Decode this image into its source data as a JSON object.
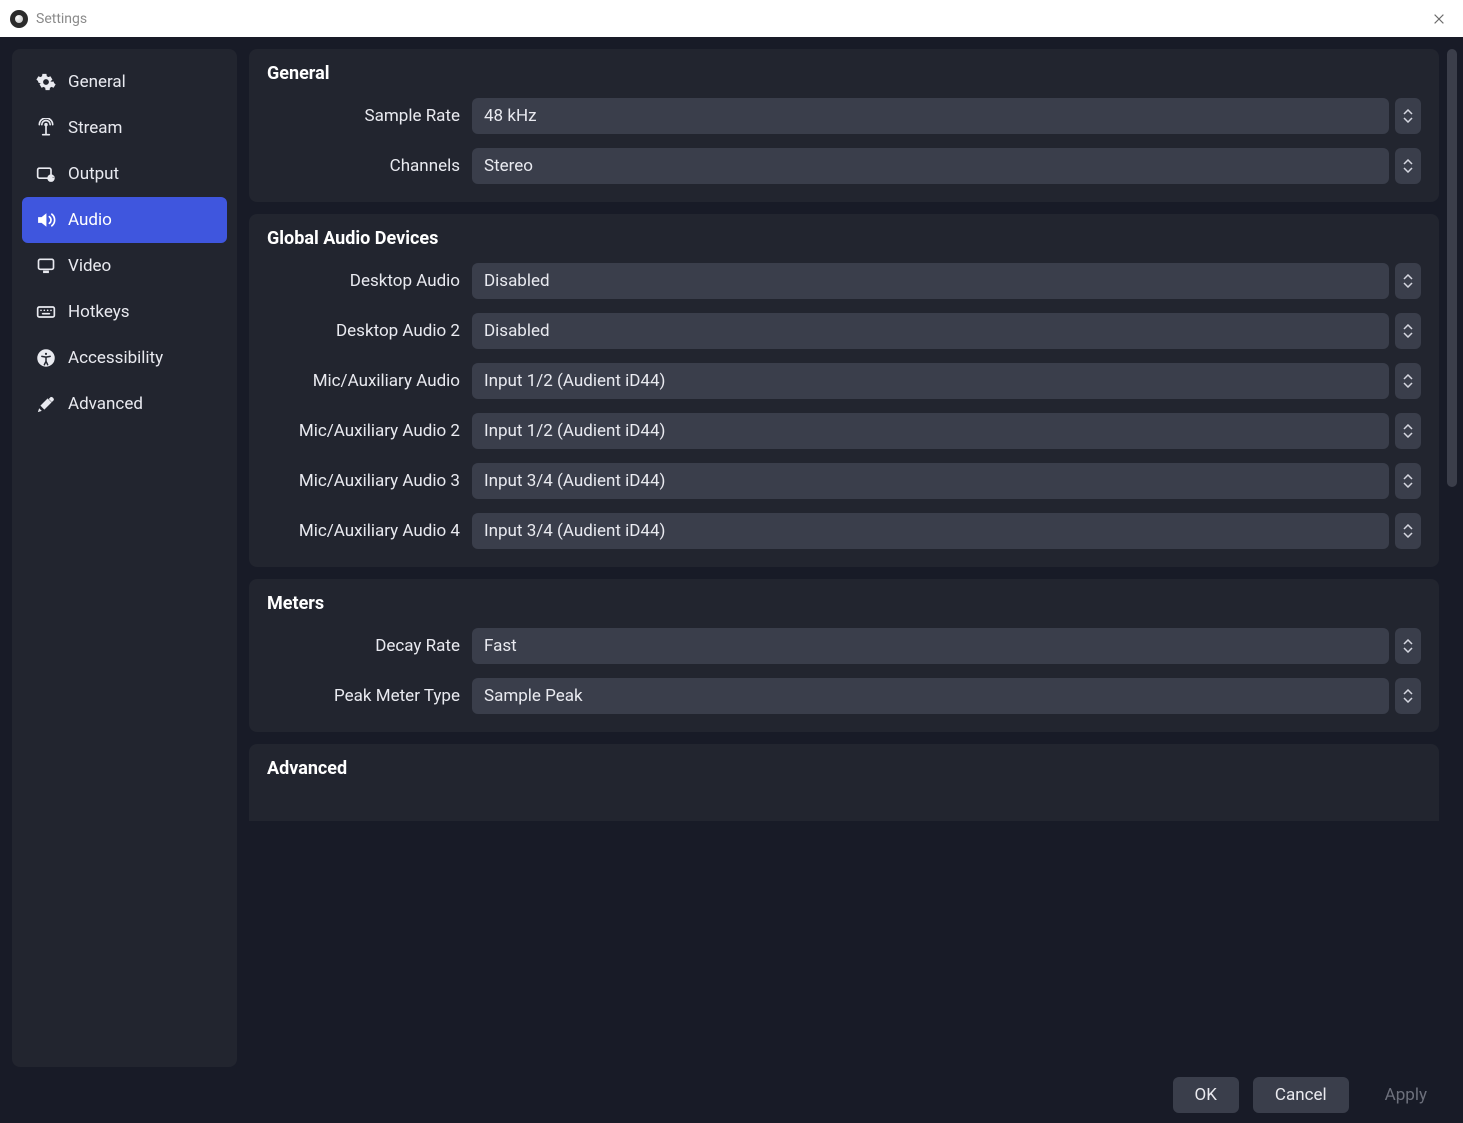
{
  "titlebar": {
    "title": "Settings"
  },
  "sidebar": {
    "items": [
      {
        "id": "general",
        "label": "General",
        "icon": "gear"
      },
      {
        "id": "stream",
        "label": "Stream",
        "icon": "antenna"
      },
      {
        "id": "output",
        "label": "Output",
        "icon": "output"
      },
      {
        "id": "audio",
        "label": "Audio",
        "icon": "speaker",
        "selected": true
      },
      {
        "id": "video",
        "label": "Video",
        "icon": "monitor"
      },
      {
        "id": "hotkeys",
        "label": "Hotkeys",
        "icon": "keyboard"
      },
      {
        "id": "accessibility",
        "label": "Accessibility",
        "icon": "accessibility"
      },
      {
        "id": "advanced",
        "label": "Advanced",
        "icon": "tools"
      }
    ]
  },
  "sections": {
    "general": {
      "title": "General",
      "rows": {
        "sample_rate": {
          "label": "Sample Rate",
          "value": "48 kHz"
        },
        "channels": {
          "label": "Channels",
          "value": "Stereo"
        }
      }
    },
    "global_devices": {
      "title": "Global Audio Devices",
      "rows": {
        "desktop1": {
          "label": "Desktop Audio",
          "value": "Disabled"
        },
        "desktop2": {
          "label": "Desktop Audio 2",
          "value": "Disabled"
        },
        "mic1": {
          "label": "Mic/Auxiliary Audio",
          "value": "Input 1/2 (Audient iD44)"
        },
        "mic2": {
          "label": "Mic/Auxiliary Audio 2",
          "value": "Input 1/2 (Audient iD44)"
        },
        "mic3": {
          "label": "Mic/Auxiliary Audio 3",
          "value": "Input 3/4 (Audient iD44)"
        },
        "mic4": {
          "label": "Mic/Auxiliary Audio 4",
          "value": "Input 3/4 (Audient iD44)"
        }
      }
    },
    "meters": {
      "title": "Meters",
      "rows": {
        "decay": {
          "label": "Decay Rate",
          "value": "Fast"
        },
        "peak": {
          "label": "Peak Meter Type",
          "value": "Sample Peak"
        }
      }
    },
    "advanced": {
      "title": "Advanced"
    }
  },
  "footer": {
    "ok": "OK",
    "cancel": "Cancel",
    "apply": "Apply"
  }
}
